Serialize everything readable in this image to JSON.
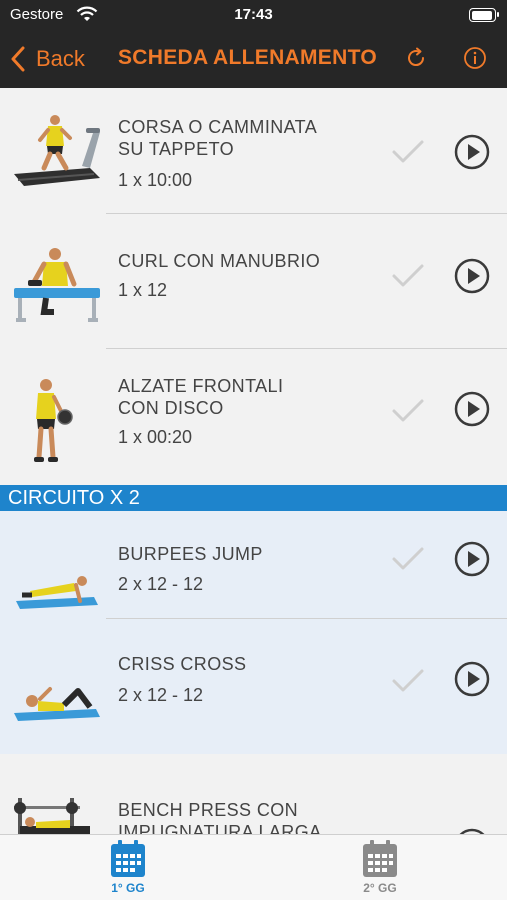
{
  "status_bar": {
    "carrier": "Gestore",
    "time": "17:43"
  },
  "nav": {
    "back_label": "Back",
    "title": "SCHEDA ALLENAMENTO",
    "accent": "#f07a2a"
  },
  "exercises": [
    {
      "name_line1": "CORSA O CAMMINATA",
      "name_line2": "SU TAPPETO",
      "reps": "1 x 10:00"
    },
    {
      "name_line1": "CURL CON MANUBRIO",
      "name_line2": "",
      "reps": "1 x 12"
    },
    {
      "name_line1": "ALZATE FRONTALI",
      "name_line2": "CON DISCO",
      "reps": "1 x 00:20"
    }
  ],
  "circuit": {
    "title": "CIRCUITO X 2",
    "color": "#1e84cc",
    "exercises": [
      {
        "name_line1": "BURPEES JUMP",
        "name_line2": "",
        "reps": "2 x 12 - 12"
      },
      {
        "name_line1": "CRISS CROSS",
        "name_line2": "",
        "reps": "2 x 12 - 12"
      }
    ]
  },
  "last_exercise": {
    "name_line1": "BENCH PRESS CON",
    "name_line2": "IMPUGNATURA LARGA"
  },
  "tabs": [
    {
      "label": "1° GG",
      "active": true,
      "color": "#1e84cc"
    },
    {
      "label": "2° GG",
      "active": false,
      "color": "#8a8a8a"
    }
  ]
}
